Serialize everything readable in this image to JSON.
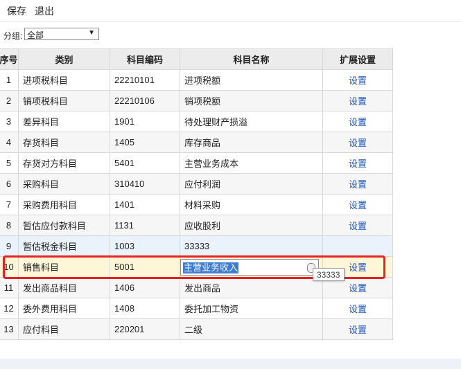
{
  "toolbar": {
    "save": "保存",
    "exit": "退出"
  },
  "filter": {
    "label": "分组:",
    "value": "全部"
  },
  "table": {
    "headers": [
      "序号",
      "类别",
      "科目编码",
      "科目名称",
      "扩展设置"
    ],
    "rows": [
      {
        "idx": "1",
        "category": "进项税科目",
        "code": "22210101",
        "name": "进项税额",
        "setting": "设置"
      },
      {
        "idx": "2",
        "category": "销项税科目",
        "code": "22210106",
        "name": "销项税额",
        "setting": "设置"
      },
      {
        "idx": "3",
        "category": "差异科目",
        "code": "1901",
        "name": "待处理财产损溢",
        "setting": "设置"
      },
      {
        "idx": "4",
        "category": "存货科目",
        "code": "1405",
        "name": "库存商品",
        "setting": "设置"
      },
      {
        "idx": "5",
        "category": "存货对方科目",
        "code": "5401",
        "name": "主营业务成本",
        "setting": "设置"
      },
      {
        "idx": "6",
        "category": "采购科目",
        "code": "310410",
        "name": "应付利润",
        "setting": "设置"
      },
      {
        "idx": "7",
        "category": "采购费用科目",
        "code": "1401",
        "name": "材料采购",
        "setting": "设置"
      },
      {
        "idx": "8",
        "category": "暂估应付款科目",
        "code": "1131",
        "name": "应收股利",
        "setting": "设置"
      },
      {
        "idx": "9",
        "category": "暂估税金科目",
        "code": "1003",
        "name": "33333",
        "setting": ""
      },
      {
        "idx": "10",
        "category": "销售科目",
        "code": "5001",
        "name": "主营业务收入",
        "setting": "设置"
      },
      {
        "idx": "11",
        "category": "发出商品科目",
        "code": "1406",
        "name": "发出商品",
        "setting": "设置"
      },
      {
        "idx": "12",
        "category": "委外费用科目",
        "code": "1408",
        "name": "委托加工物资",
        "setting": "设置"
      },
      {
        "idx": "13",
        "category": "应付科目",
        "code": "220201",
        "name": "二级",
        "setting": "设置"
      }
    ]
  },
  "tooltip": "33333",
  "colors": {
    "link": "#1a55c8",
    "highlight_border": "#e82020",
    "selection": "#3a7bd5"
  }
}
